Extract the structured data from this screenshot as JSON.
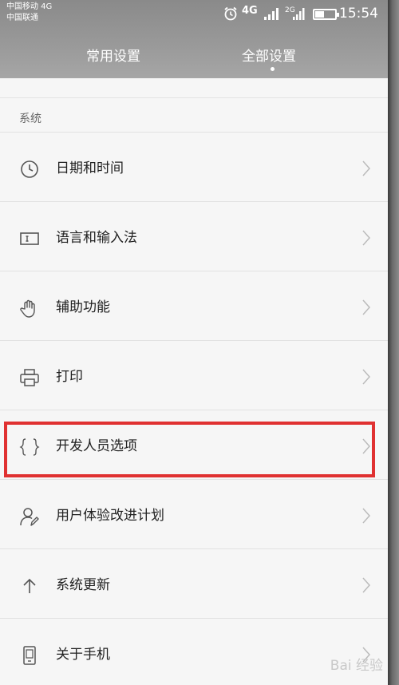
{
  "status_bar": {
    "carrier_1": "中国移动 4G",
    "carrier_2": "中国联通",
    "network_1": "4G",
    "network_2": "2G",
    "time": "15:54",
    "battery_level": 0.45,
    "icons": [
      "alarm-icon",
      "signal-4g-icon",
      "signal-2g-icon",
      "battery-icon"
    ]
  },
  "tabs": {
    "common": "常用设置",
    "all": "全部设置",
    "active": "all"
  },
  "section": {
    "header": "系统"
  },
  "items": [
    {
      "label": "日期和时间",
      "icon": "clock-icon"
    },
    {
      "label": "语言和输入法",
      "icon": "keyboard-input-icon"
    },
    {
      "label": "辅助功能",
      "icon": "hand-icon"
    },
    {
      "label": "打印",
      "icon": "printer-icon"
    },
    {
      "label": "开发人员选项",
      "icon": "braces-icon",
      "highlighted": true
    },
    {
      "label": "用户体验改进计划",
      "icon": "user-edit-icon"
    },
    {
      "label": "系统更新",
      "icon": "arrow-up-icon"
    },
    {
      "label": "关于手机",
      "icon": "phone-icon"
    }
  ],
  "highlight_color": "#e03131",
  "watermark": "Bai 经验"
}
